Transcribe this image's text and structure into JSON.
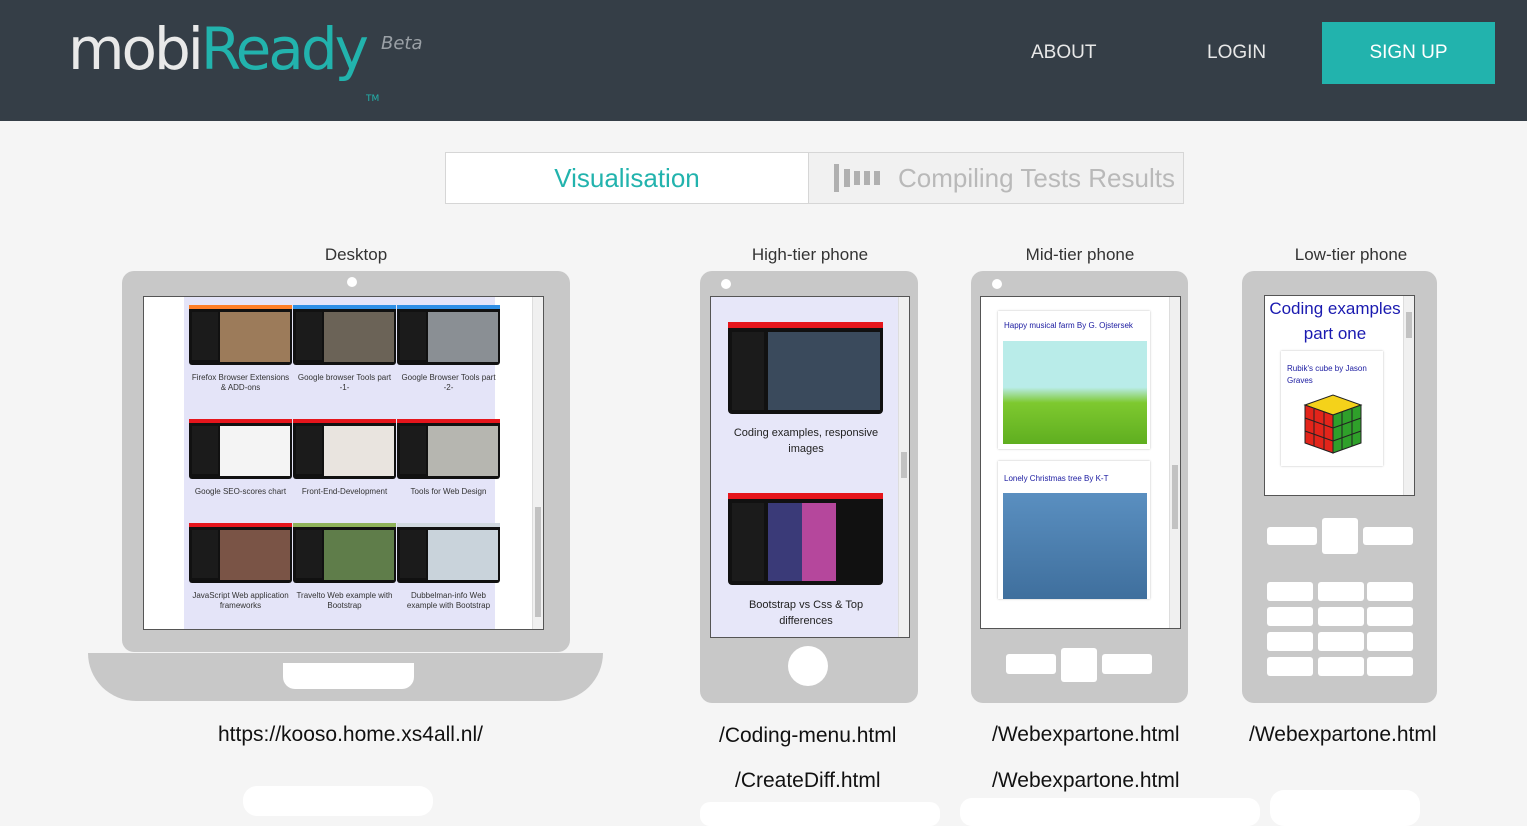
{
  "brand": {
    "name_part1": "mobi",
    "name_part2": "Ready",
    "tm": "TM",
    "badge": "Beta",
    "accent": "#22b3ad",
    "header_bg": "#353e47"
  },
  "nav": {
    "about": "ABOUT",
    "login": "LOGIN",
    "signup": "SIGN UP"
  },
  "tabs": {
    "visualisation": "Visualisation",
    "compiling": "Compiling Tests Results",
    "compiling_icon": "bars-chart-icon"
  },
  "devices": {
    "desktop": {
      "label": "Desktop",
      "thumbs": [
        {
          "caption": "Firefox Browser Extensions & ADD-ons",
          "bar": "#ff7f27",
          "pic": "#9c7b5a"
        },
        {
          "caption": "Google browser Tools part -1-",
          "bar": "#2f8fe6",
          "pic": "#6b6357"
        },
        {
          "caption": "Google Browser Tools part -2-",
          "bar": "#2f8fe6",
          "pic": "#8a8f94"
        },
        {
          "caption": "Google SEO-scores chart",
          "bar": "#e5151c",
          "pic": "#f4f4f4"
        },
        {
          "caption": "Front-End-Development",
          "bar": "#e5151c",
          "pic": "#e9e4df"
        },
        {
          "caption": "Tools for Web Design",
          "bar": "#e5151c",
          "pic": "#b6b6b0"
        },
        {
          "caption": "JavaScript Web application frameworks",
          "bar": "#e5151c",
          "pic": "#7a5446"
        },
        {
          "caption": "Travelto Web example with Bootstrap",
          "bar": "#8fb35a",
          "pic": "#5f7d4a"
        },
        {
          "caption": "Dubbelman-info Web example with Bootstrap",
          "bar": "#d0d8df",
          "pic": "#c9d3db"
        }
      ],
      "url": "https://kooso.home.xs4all.nl/"
    },
    "high": {
      "label": "High-tier phone",
      "cards": [
        {
          "caption": "Coding examples, responsive images"
        },
        {
          "caption": "Bootstrap vs Css & Top differences"
        }
      ],
      "urls": [
        "/Coding-menu.html",
        "/CreateDiff.html"
      ]
    },
    "mid": {
      "label": "Mid-tier phone",
      "cards": [
        {
          "title": "Happy musical farm By G. Ojstersek"
        },
        {
          "title": "Lonely Christmas tree By K-T"
        }
      ],
      "urls": [
        "/Webexpartone.html",
        "/Webexpartone.html"
      ]
    },
    "low": {
      "label": "Low-tier phone",
      "heading": "Coding examples part one",
      "card_title": "Rubik's cube by Jason Graves",
      "url": "/Webexpartone.html"
    }
  }
}
